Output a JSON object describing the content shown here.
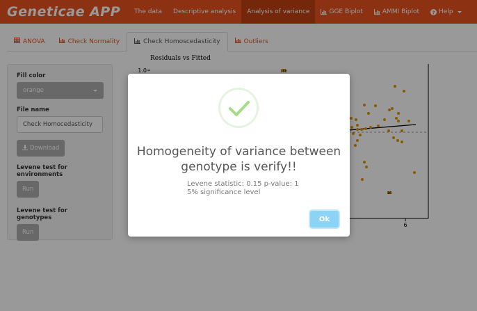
{
  "app": {
    "title": "Geneticae APP"
  },
  "nav": {
    "items": [
      {
        "label": "The data",
        "icon": ""
      },
      {
        "label": "Descriptive analysis",
        "icon": ""
      },
      {
        "label": "Analysis of variance",
        "icon": "",
        "active": true
      },
      {
        "label": "GGE Biplot",
        "icon": "bar-chart-icon"
      },
      {
        "label": "AMMI Biplot",
        "icon": "bar-chart-icon"
      },
      {
        "label": "Help",
        "icon": "question-circle-icon"
      }
    ]
  },
  "tabs": [
    {
      "label": "ANOVA",
      "icon": "table-icon"
    },
    {
      "label": "Check Normality",
      "icon": "bar-chart-icon"
    },
    {
      "label": "Check Homoscedasticity",
      "icon": "bar-chart-icon",
      "active": true
    },
    {
      "label": "Outliers",
      "icon": "bar-chart-icon"
    }
  ],
  "sidebar": {
    "fill_color_label": "Fill color",
    "fill_color_value": "orange",
    "file_name_label": "File name",
    "file_name_value": "Check Homocedasticity",
    "download_label": "Download",
    "levene_env_label": "Levene test for environments",
    "levene_env_button": "Run",
    "levene_gen_label": "Levene test for genotypes",
    "levene_gen_button": "Run"
  },
  "chart_data": {
    "type": "scatter",
    "title": "Residuals vs Fitted",
    "visible_tick_labels": {
      "y": [
        "1.0"
      ],
      "x": [
        "6"
      ]
    },
    "point_color": "#e69500"
  },
  "modal": {
    "title": "Homogeneity of variance between genotype is verify!!",
    "line1": "Levene statistic: 0.15 p-value: 1",
    "line2": "5% significance level",
    "ok_label": "Ok"
  },
  "colors": {
    "navbar": "#e95420",
    "active_nav": "#c34113",
    "ok_button": "#8cd4f5",
    "success_check": "#a5dc86"
  }
}
